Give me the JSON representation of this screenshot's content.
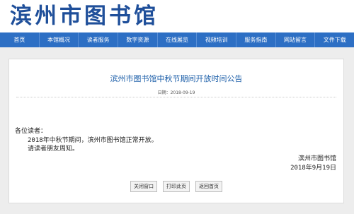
{
  "site": {
    "logo_text": "滨州市图书馆"
  },
  "nav": {
    "items": [
      {
        "label": "首页"
      },
      {
        "label": "本馆概况"
      },
      {
        "label": "读者服务"
      },
      {
        "label": "数字资源"
      },
      {
        "label": "在线展览"
      },
      {
        "label": "视频培训"
      },
      {
        "label": "服务指南"
      },
      {
        "label": "网站留言"
      },
      {
        "label": "文件下载"
      }
    ]
  },
  "article": {
    "title": "滨州市图书馆中秋节期间开放时间公告",
    "date": "日期：2018-09-19",
    "greeting": "各位读者：",
    "paragraph1": "2018年中秋节期间，滨州市图书馆正常开放。",
    "paragraph2": "请读者朋友周知。",
    "signature_org": "滨州市图书馆",
    "signature_date": "2018年9月19日"
  },
  "actions": {
    "close": "关闭窗口",
    "print": "打印此页",
    "home": "返回首页"
  },
  "colors": {
    "brand_blue": "#1f4f9a",
    "nav_bg": "#2d6fc4",
    "title_blue": "#1a5da8"
  }
}
